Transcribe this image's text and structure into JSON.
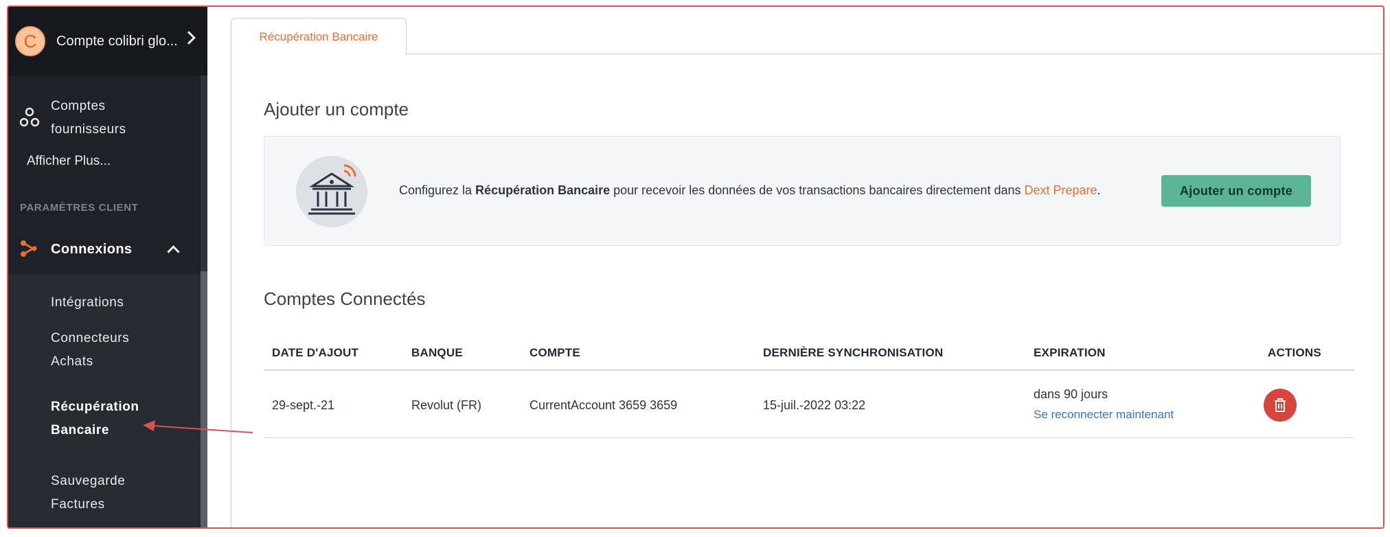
{
  "sidebar": {
    "org": {
      "avatar_letter": "C",
      "name": "Compte colibri glo..."
    },
    "suppliers_line1": "Comptes",
    "suppliers_line2": "fournisseurs",
    "show_more": "Afficher Plus...",
    "section_title": "PARAMÈTRES CLIENT",
    "connexions": "Connexions",
    "sub_items": [
      {
        "line1": "Intégrations",
        "line2": ""
      },
      {
        "line1": "Connecteurs",
        "line2": "Achats"
      },
      {
        "line1": "Récupération",
        "line2": "Bancaire"
      },
      {
        "line1": "Sauvegarde",
        "line2": "Factures"
      }
    ]
  },
  "tab": {
    "label": "Récupération Bancaire"
  },
  "add_section": {
    "title": "Ajouter un compte",
    "text_prefix": "Configurez la ",
    "text_bold": "Récupération Bancaire",
    "text_middle": " pour recevoir les données de vos transactions bancaires directement dans ",
    "text_link": "Dext Prepare",
    "text_suffix": ".",
    "button": "Ajouter un compte"
  },
  "connected": {
    "title": "Comptes Connectés",
    "headers": [
      "DATE D'AJOUT",
      "BANQUE",
      "COMPTE",
      "DERNIÈRE SYNCHRONISATION",
      "EXPIRATION",
      "ACTIONS"
    ],
    "row": {
      "date": "29-sept.-21",
      "bank": "Revolut (FR)",
      "account": "CurrentAccount 3659 3659",
      "last_sync": "15-juil.-2022 03:22",
      "expiration": "dans 90 jours",
      "reconnect": "Se reconnecter maintenant"
    }
  },
  "colors": {
    "accent_orange": "#e8702f",
    "button_green": "#5bb398",
    "delete_red": "#d8453f",
    "link_blue": "#3b73c9",
    "annotation_red": "#d9534f"
  }
}
